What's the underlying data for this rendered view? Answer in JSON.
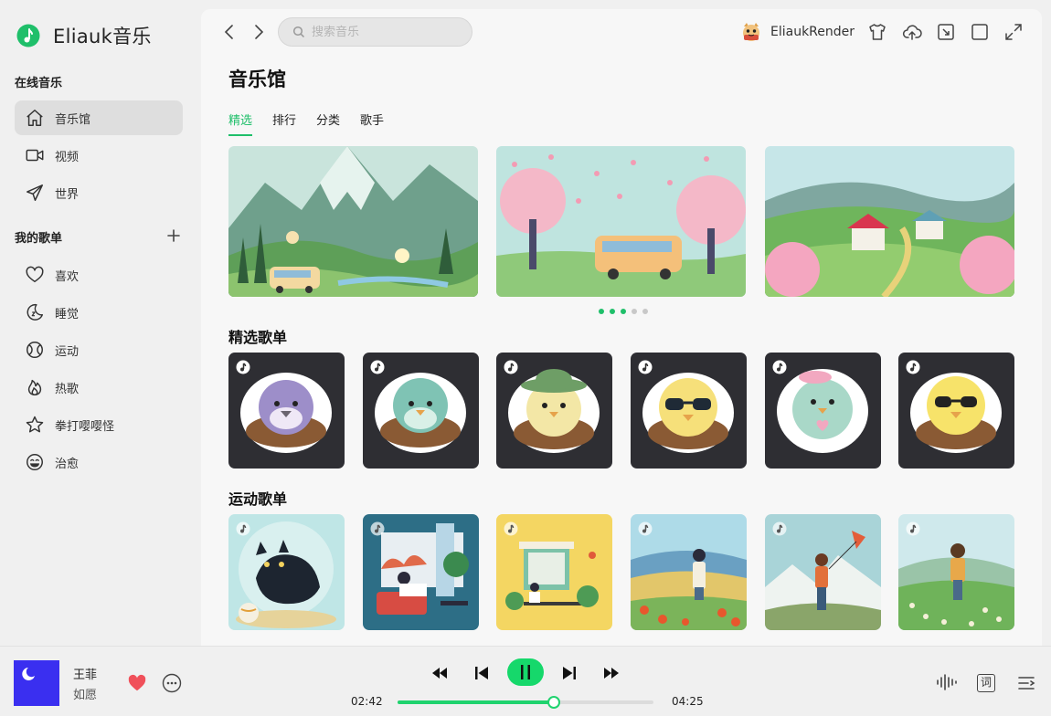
{
  "app": {
    "name": "Eliauk音乐",
    "brand_color": "#1fbf6a"
  },
  "sidebar": {
    "online_title": "在线音乐",
    "online_items": [
      {
        "label": "音乐馆",
        "icon": "home-icon",
        "active": true
      },
      {
        "label": "视频",
        "icon": "video-icon"
      },
      {
        "label": "世界",
        "icon": "send-icon"
      }
    ],
    "mine_title": "我的歌单",
    "mine_items": [
      {
        "label": "喜欢",
        "icon": "heart-icon"
      },
      {
        "label": "睡觉",
        "icon": "moon-icon"
      },
      {
        "label": "运动",
        "icon": "ball-icon"
      },
      {
        "label": "热歌",
        "icon": "fire-icon"
      },
      {
        "label": "拳打嘤嘤怪",
        "icon": "star-icon"
      },
      {
        "label": "治愈",
        "icon": "smile-icon"
      }
    ]
  },
  "header": {
    "search_placeholder": "搜索音乐",
    "username": "EliaukRender",
    "tools": [
      "shirt-icon",
      "upload-cloud-icon",
      "mini-mode-icon",
      "window-icon",
      "fullscreen-icon"
    ]
  },
  "main": {
    "title": "音乐馆",
    "tabs": [
      {
        "label": "精选",
        "active": true
      },
      {
        "label": "排行"
      },
      {
        "label": "分类"
      },
      {
        "label": "歌手"
      }
    ],
    "carousel": {
      "count": 5,
      "active_dots": 3
    },
    "featured_title": "精选歌单",
    "sport_title": "运动歌单"
  },
  "player": {
    "song": "王菲",
    "artist": "如愿",
    "current_time": "02:42",
    "total_time": "04:25",
    "progress": 0.61,
    "lyric_label": "词",
    "liked": true
  }
}
